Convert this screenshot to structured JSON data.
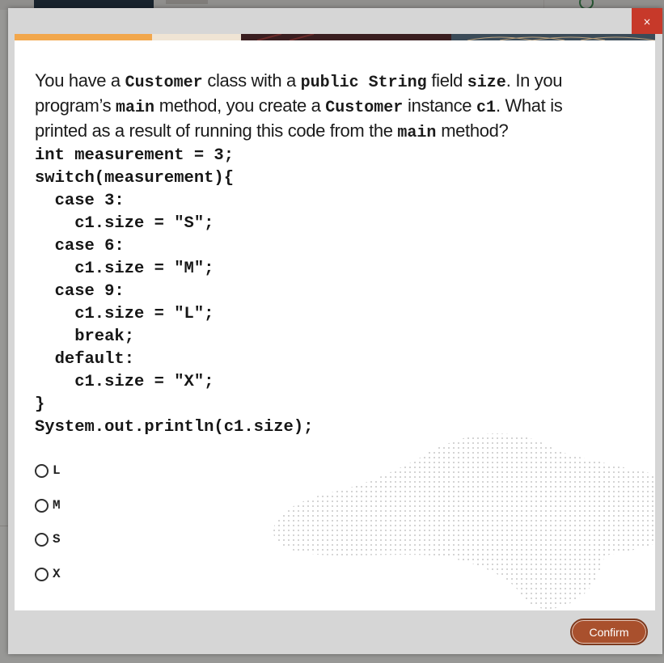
{
  "modal": {
    "close_label": "×",
    "question": {
      "t1": "You have a ",
      "c1": "Customer",
      "t2": " class with a ",
      "c2": "public String",
      "t3": " field ",
      "c3": "size",
      "t4": ". In you program’s ",
      "c4": "main",
      "t5": " method, you create a ",
      "c5": "Customer",
      "t6": " instance ",
      "c6": "c1",
      "t7": ". What is printed as a result of running this code from the ",
      "c7": "main",
      "t8": " method?"
    },
    "code_lines": [
      "int measurement = 3;",
      "switch(measurement){",
      "  case 3:",
      "    c1.size = \"S\";",
      "  case 6:",
      "    c1.size = \"M\";",
      "  case 9:",
      "    c1.size = \"L\";",
      "    break;",
      "  default:",
      "    c1.size = \"X\";",
      "}",
      "System.out.println(c1.size);"
    ],
    "options": [
      "L",
      "M",
      "S",
      "X"
    ],
    "confirm_label": "Confirm"
  },
  "colors": {
    "close_button": "#c7392a",
    "confirm_button": "#a9502d",
    "modal_footer": "#d6d6d6"
  },
  "icons": {
    "close": "close-icon",
    "background_check": "check-circle-icon"
  }
}
